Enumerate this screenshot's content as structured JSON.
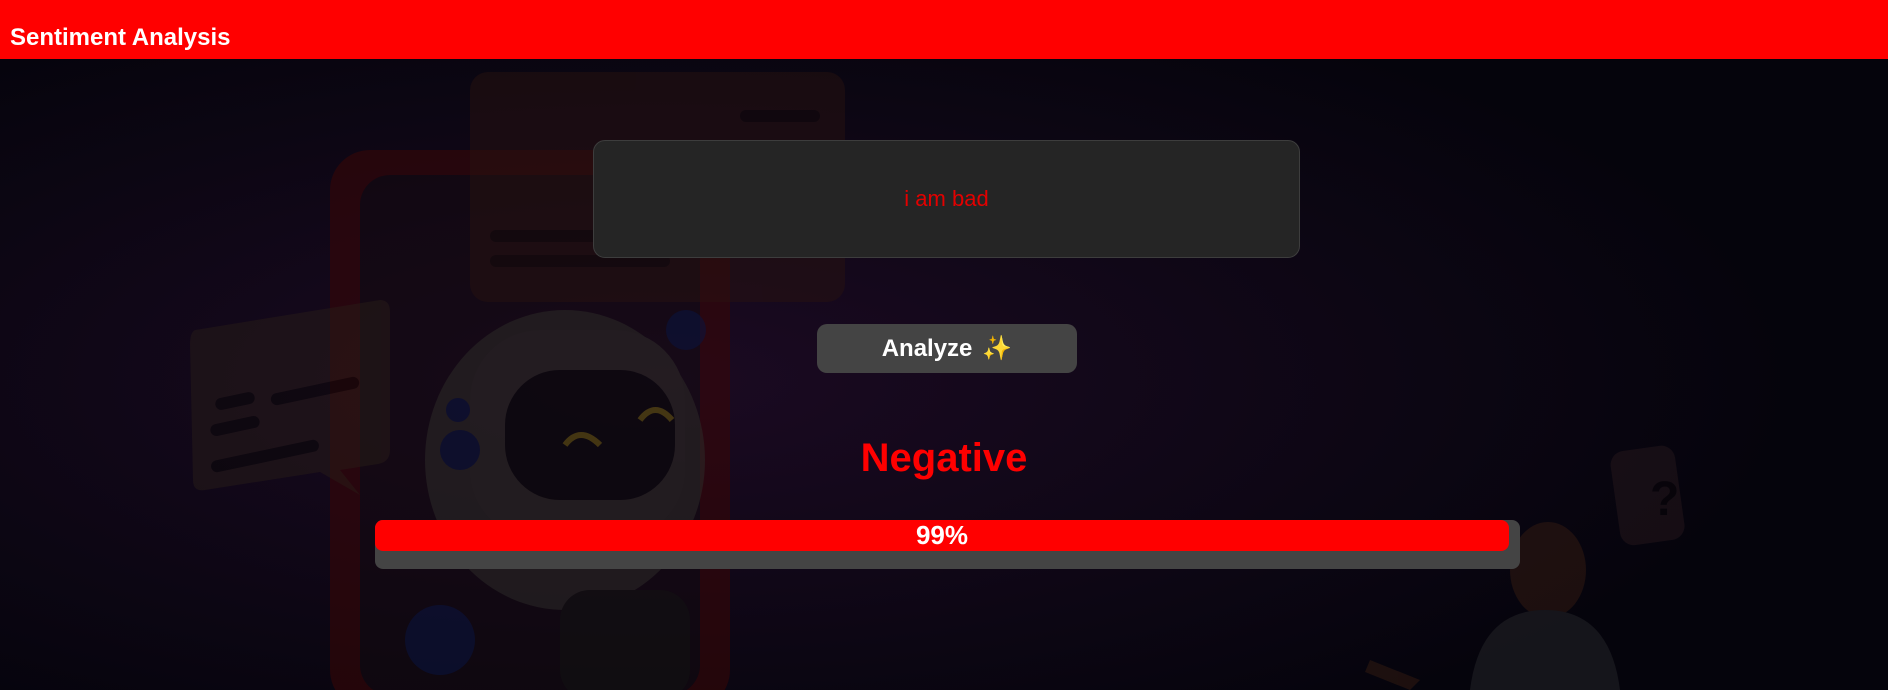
{
  "app": {
    "title": "Sentiment Analysis"
  },
  "input": {
    "value": "i am bad"
  },
  "analyze_button": {
    "label": "Analyze",
    "icon": "sparkles-icon",
    "icon_glyph": "✨"
  },
  "result": {
    "label": "Negative",
    "confidence_text": "99%",
    "confidence_fraction": 0.99
  },
  "colors": {
    "accent": "#ff0000",
    "panel": "#252525",
    "button": "#444444",
    "background": "#05040c"
  }
}
